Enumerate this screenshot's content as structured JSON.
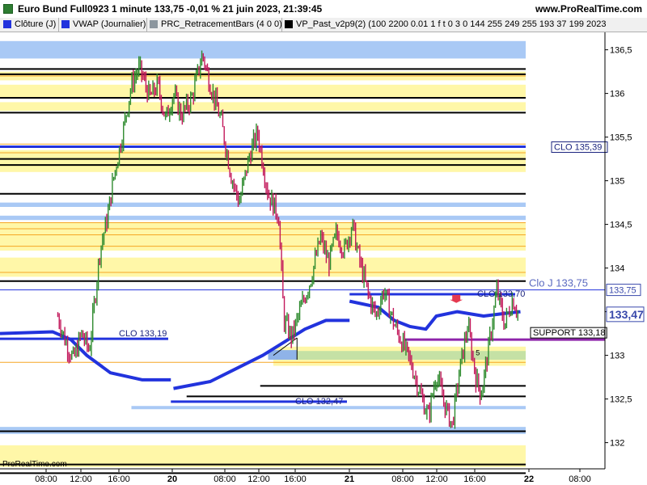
{
  "window": {
    "title": "Euro Bund Full0923 1 minute 133,75 -0,01 % 21 juin 2023, 21:39:45",
    "site": "www.ProRealTime.com",
    "watermark": "ProRealTime.com"
  },
  "legend": [
    {
      "label": "Clôture (J)",
      "color": "#2233dd"
    },
    {
      "label": "VWAP (Journalier)",
      "color": "#2233dd"
    },
    {
      "label": "PRC_RetracementBars (4 0 0)",
      "color": "#8c969e"
    },
    {
      "label": "VP_Past_v2p9(2) (100 2200 0.01 1 f t 0 3 0 144 255 249 255 193 37 199 2023",
      "color": "#000000"
    }
  ],
  "chart_data": {
    "type": "candlestick",
    "instrument": "Euro Bund Full0923",
    "timeframe": "1 minute",
    "last_price": 133.47,
    "ylim": [
      131.7,
      136.7
    ],
    "y_ticks": [
      "136,5",
      "136",
      "135,5",
      "135",
      "134,5",
      "134",
      "133,5",
      "133",
      "132,5",
      "132"
    ],
    "y_tick_values": [
      136.5,
      136,
      135.5,
      135,
      134.5,
      134,
      133.5,
      133,
      132.5,
      132
    ],
    "x_ticks": [
      "08:00",
      "12:00",
      "16:00",
      "20",
      "08:00",
      "12:00",
      "16:00",
      "21",
      "08:00",
      "12:00",
      "16:00",
      "22",
      "08:00"
    ],
    "x_bold": [
      false,
      false,
      false,
      true,
      false,
      false,
      false,
      true,
      false,
      false,
      false,
      true,
      false
    ],
    "price_path": [
      [
        0.11,
        133.45
      ],
      [
        0.125,
        133.15
      ],
      [
        0.14,
        132.95
      ],
      [
        0.155,
        133.25
      ],
      [
        0.17,
        133.05
      ],
      [
        0.19,
        134.2
      ],
      [
        0.205,
        134.6
      ],
      [
        0.215,
        135.0
      ],
      [
        0.235,
        135.6
      ],
      [
        0.25,
        136.1
      ],
      [
        0.265,
        136.3
      ],
      [
        0.285,
        135.95
      ],
      [
        0.3,
        136.1
      ],
      [
        0.315,
        135.7
      ],
      [
        0.33,
        136.0
      ],
      [
        0.345,
        135.75
      ],
      [
        0.365,
        135.95
      ],
      [
        0.385,
        136.45
      ],
      [
        0.4,
        136.1
      ],
      [
        0.42,
        135.7
      ],
      [
        0.44,
        135.05
      ],
      [
        0.455,
        134.75
      ],
      [
        0.475,
        135.3
      ],
      [
        0.49,
        135.55
      ],
      [
        0.51,
        134.85
      ],
      [
        0.53,
        134.6
      ],
      [
        0.54,
        133.4
      ],
      [
        0.555,
        133.2
      ],
      [
        0.57,
        133.5
      ],
      [
        0.59,
        133.85
      ],
      [
        0.61,
        134.35
      ],
      [
        0.625,
        134.05
      ],
      [
        0.64,
        134.4
      ],
      [
        0.655,
        134.2
      ],
      [
        0.67,
        134.5
      ],
      [
        0.685,
        134.05
      ],
      [
        0.7,
        133.7
      ],
      [
        0.715,
        133.45
      ],
      [
        0.73,
        133.75
      ],
      [
        0.75,
        133.35
      ],
      [
        0.765,
        133.15
      ],
      [
        0.785,
        132.85
      ],
      [
        0.8,
        132.55
      ],
      [
        0.815,
        132.3
      ],
      [
        0.83,
        132.8
      ],
      [
        0.845,
        132.45
      ],
      [
        0.86,
        132.2
      ],
      [
        0.875,
        132.85
      ],
      [
        0.89,
        133.35
      ],
      [
        0.905,
        132.75
      ],
      [
        0.915,
        132.55
      ],
      [
        0.93,
        133.1
      ],
      [
        0.945,
        133.75
      ],
      [
        0.96,
        133.35
      ],
      [
        0.975,
        133.65
      ],
      [
        0.985,
        133.5
      ]
    ],
    "vwap_segments": [
      [
        [
          0.0,
          133.25
        ],
        [
          0.1,
          133.27
        ],
        [
          0.135,
          133.18
        ],
        [
          0.165,
          133.0
        ],
        [
          0.21,
          132.8
        ],
        [
          0.27,
          132.72
        ],
        [
          0.325,
          132.72
        ]
      ],
      [
        [
          0.33,
          132.62
        ],
        [
          0.4,
          132.7
        ],
        [
          0.45,
          132.85
        ],
        [
          0.5,
          133.0
        ],
        [
          0.54,
          133.15
        ],
        [
          0.58,
          133.3
        ],
        [
          0.62,
          133.4
        ],
        [
          0.665,
          133.4
        ]
      ],
      [
        [
          0.665,
          133.62
        ],
        [
          0.72,
          133.55
        ],
        [
          0.75,
          133.4
        ],
        [
          0.78,
          133.33
        ],
        [
          0.81,
          133.3
        ],
        [
          0.83,
          133.45
        ],
        [
          0.87,
          133.5
        ],
        [
          0.92,
          133.45
        ],
        [
          0.96,
          133.48
        ],
        [
          0.99,
          133.5
        ]
      ]
    ],
    "levels": {
      "clo_lines": [
        {
          "label": "CLO 133,19",
          "price": 133.19
        },
        {
          "label": "CLO 133,70",
          "price": 133.7
        },
        {
          "label": "CLO 132,47",
          "price": 132.47
        },
        {
          "label": "CLO 135,39",
          "price": 135.39
        }
      ],
      "support": {
        "label": "SUPPORT 133,18",
        "price": 133.18
      },
      "clo_j": {
        "label": "Clo J 133,75",
        "price": 133.75
      },
      "axis_badges": [
        {
          "text": "133,75",
          "price": 133.75
        },
        {
          "text": "133,47",
          "price": 133.47
        }
      ],
      "marker_text": "5"
    },
    "colors": {
      "up": "#2e8b2e",
      "down": "#c2185b",
      "vwap": "#2233dd",
      "yellow_band": "#fff7a8",
      "blue_band": "#a9c9f5",
      "support": "#8e24aa",
      "clo_line": "#2233dd"
    }
  }
}
